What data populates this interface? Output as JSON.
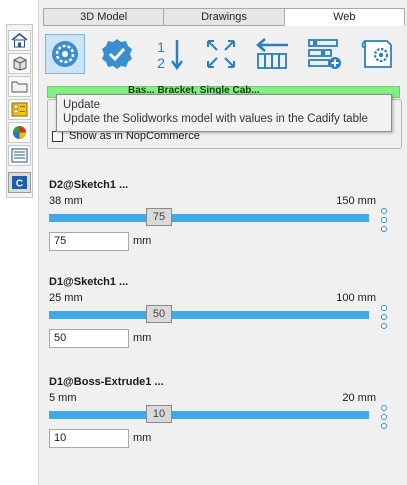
{
  "tabs": [
    {
      "label": "3D Model",
      "active": false
    },
    {
      "label": "Drawings",
      "active": false
    },
    {
      "label": "Web",
      "active": true
    }
  ],
  "left_bar": {
    "icons": [
      "home-icon",
      "parts-icon",
      "folder-icon",
      "properties-icon",
      "appearance-icon",
      "list-icon",
      "cadify-icon"
    ]
  },
  "toolbar": {
    "buttons": [
      "model-settings-icon",
      "update-check-icon",
      "sort-order-icon",
      "fit-icon",
      "columns-icon",
      "add-config-icon",
      "sheet-settings-icon"
    ]
  },
  "green_bar": {
    "text": "Bas... Bracket, Single Cab..."
  },
  "tooltip": {
    "title": "Update",
    "text": "Update the Solidworks model with  values in the Cadify table"
  },
  "options": {
    "show_nop_label": "Show as in NopCommerce",
    "show_nop_checked": false
  },
  "dimensions": [
    {
      "name": "D2@Sketch1  ...",
      "min": "38 mm",
      "max": "150 mm",
      "value": "75",
      "unit": "mm",
      "slider_fraction": 0.33
    },
    {
      "name": "D1@Sketch1  ...",
      "min": "25 mm",
      "max": "100 mm",
      "value": "50",
      "unit": "mm",
      "slider_fraction": 0.33
    },
    {
      "name": "D1@Boss-Extrude1  ...",
      "min": "5 mm",
      "max": "20 mm",
      "value": "10",
      "unit": "mm",
      "slider_fraction": 0.33
    }
  ],
  "colors": {
    "accent": "#3fa9e6",
    "green": "#86ee86",
    "icon_blue": "#2d7fc1"
  }
}
